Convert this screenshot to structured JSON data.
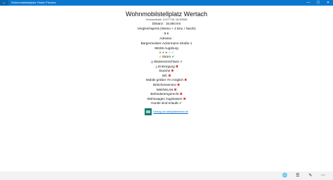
{
  "window": {
    "title": "Wohnmobilstellplatz Finder Preview",
    "back_glyph": "←",
    "controls": [
      "—",
      "☐",
      "✕"
    ]
  },
  "place": {
    "title": "Wohnmobilstellplatz Wertach",
    "coordinates": "Geokoordinate: 10,677748 / 48,359684",
    "distance": "Distanz : 16,684 km",
    "price_label": "Vergleichspreis (Womo + 2 Erw. / Nacht)",
    "price": "8 €",
    "address_label": "Adresse :",
    "street": "Bürgermeister-Ackermann-Straße 1",
    "city": "86156 Augsburg",
    "rating": {
      "value": 3,
      "max": 5
    }
  },
  "features": [
    {
      "label": "Strom",
      "available": true,
      "icon": "plug-icon"
    },
    {
      "label": "Wasseranschluss",
      "available": true,
      "icon": "water-tap-icon"
    },
    {
      "label": "Entsorgung",
      "available": false,
      "icon": "disposal-icon"
    },
    {
      "label": "Dusche",
      "available": false
    },
    {
      "label": "WC",
      "available": false
    },
    {
      "label": "Mobile größer 7m möglich",
      "available": false
    },
    {
      "label": "Brötchenservice",
      "available": false
    },
    {
      "label": "Web/WLAN",
      "available": false
    },
    {
      "label": "Behindertengerecht",
      "available": false
    },
    {
      "label": "Wohnwagen zugelassen",
      "available": false
    },
    {
      "label": "Hunde sind erlaubt",
      "available": true
    }
  ],
  "source": {
    "link_text": "Eintrag von stellplatzfuehrer.de",
    "icon": "source-logo-icon"
  },
  "appbar": {
    "icons": [
      {
        "name": "globe-icon",
        "glyph": "🌐"
      },
      {
        "name": "list-icon",
        "glyph": "☰"
      },
      {
        "name": "edit-icon",
        "glyph": "✎"
      },
      {
        "name": "more-icon",
        "glyph": "⋯"
      }
    ]
  },
  "colors": {
    "titlebar": "#0a77cf",
    "available": "#2a9d2a",
    "unavailable": "#d21d1d",
    "link": "#0b6fd6"
  }
}
